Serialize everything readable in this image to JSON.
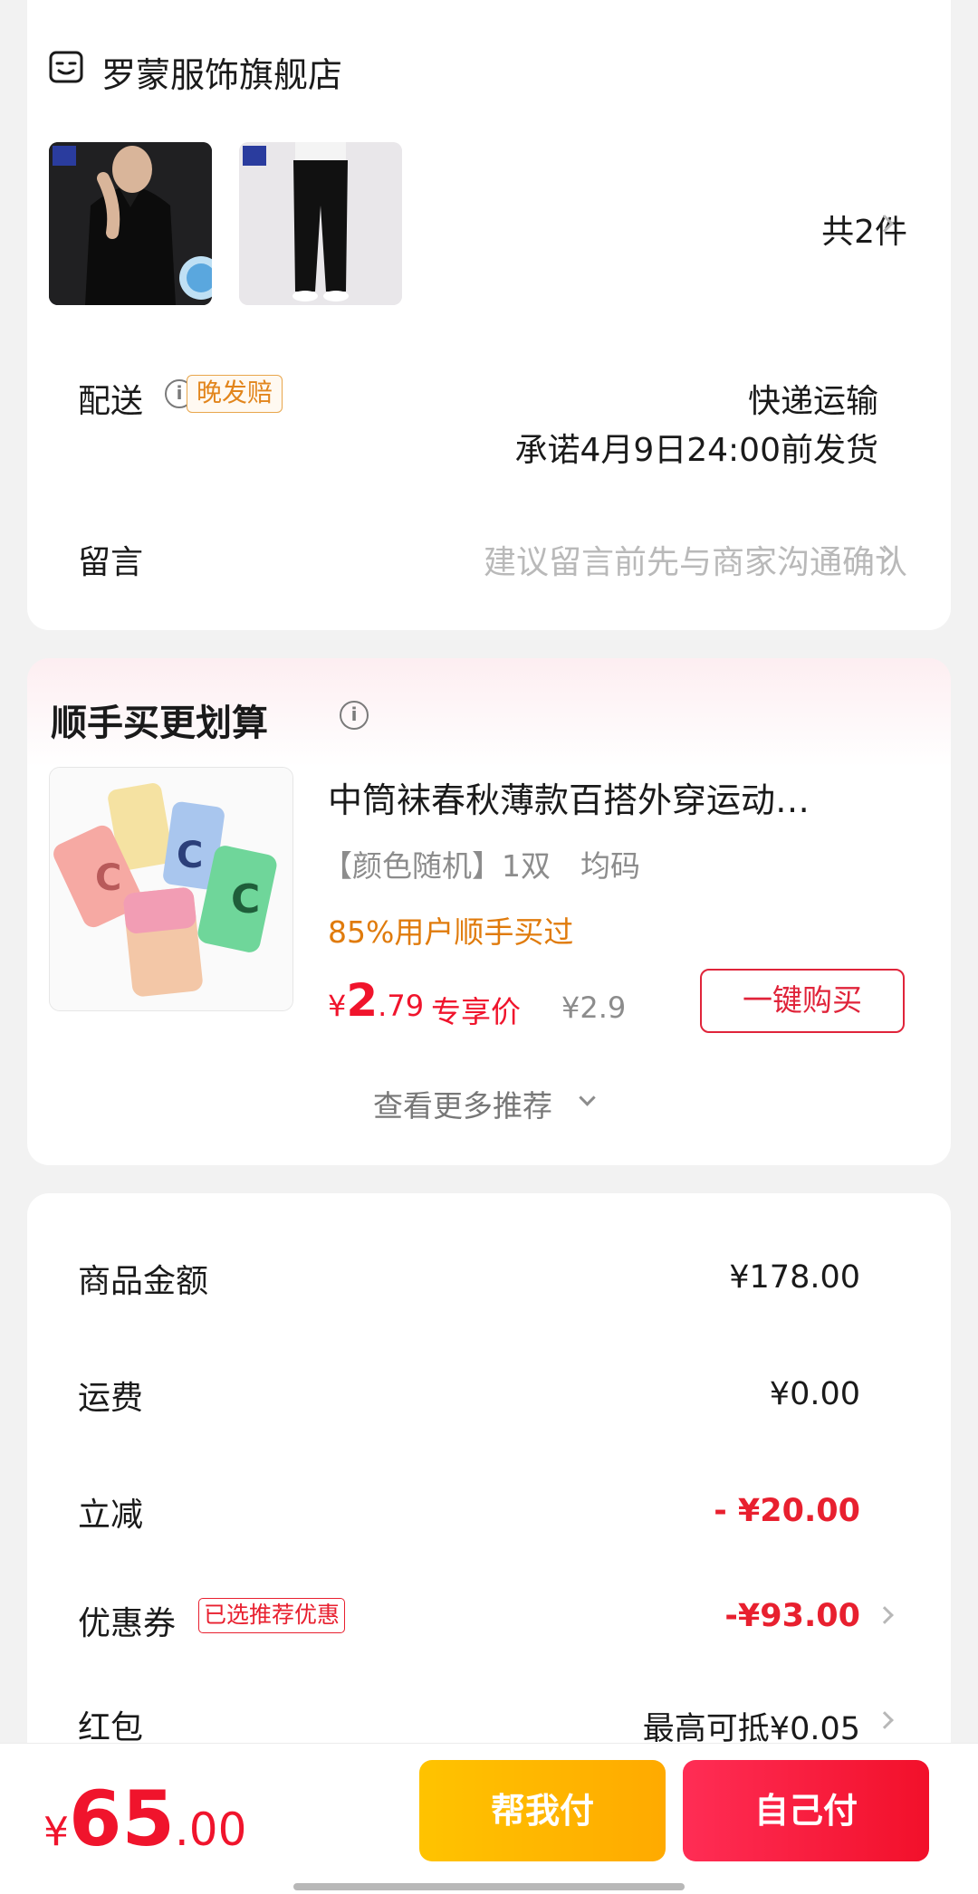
{
  "store": {
    "name": "罗蒙服饰旗舰店",
    "icon": "store-icon",
    "item_count": "共2件"
  },
  "delivery": {
    "label": "配送",
    "badge": "晚发赔",
    "method": "快递运输",
    "promise": "承诺4月9日24:00前发货"
  },
  "note": {
    "label": "留言",
    "placeholder": "建议留言前先与商家沟通确认"
  },
  "upsell": {
    "title": "顺手买更划算",
    "product": {
      "title": "中筒袜春秋薄款百搭外穿运动…",
      "spec": "【颜色随机】1双　均码",
      "bought_ratio": "85%用户顺手买过",
      "price_currency": "¥",
      "price_int": "2",
      "price_dec": ".79",
      "price_tag": "专享价",
      "original_price": "¥2.9",
      "buy_button": "一键购买"
    },
    "more": "查看更多推荐"
  },
  "fees": {
    "goods_label": "商品金额",
    "goods_value": "¥178.00",
    "shipping_label": "运费",
    "shipping_value": "¥0.00",
    "discount_label": "立减",
    "discount_value": "- ¥20.00",
    "coupon_label": "优惠券",
    "coupon_badge": "已选推荐优惠",
    "coupon_value": "-¥93.00",
    "redpacket_label": "红包",
    "redpacket_value": "最高可抵¥0.05"
  },
  "footer": {
    "total_currency": "¥",
    "total_int": "65",
    "total_dec": ".00",
    "help_pay": "帮我付",
    "self_pay": "自己付"
  },
  "colors": {
    "accent_red": "#f0142c",
    "help_yellow": "#ffb800",
    "late_orange": "#e2851c"
  }
}
